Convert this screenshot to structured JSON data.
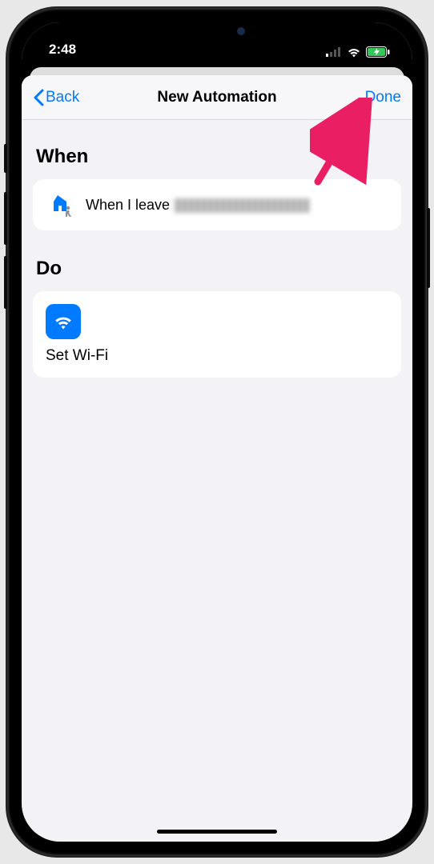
{
  "status": {
    "time": "2:48"
  },
  "nav": {
    "back_label": "Back",
    "title": "New Automation",
    "done_label": "Done"
  },
  "sections": {
    "when": {
      "title": "When",
      "trigger_prefix": "When I leave"
    },
    "do": {
      "title": "Do",
      "action_label": "Set Wi-Fi"
    }
  }
}
